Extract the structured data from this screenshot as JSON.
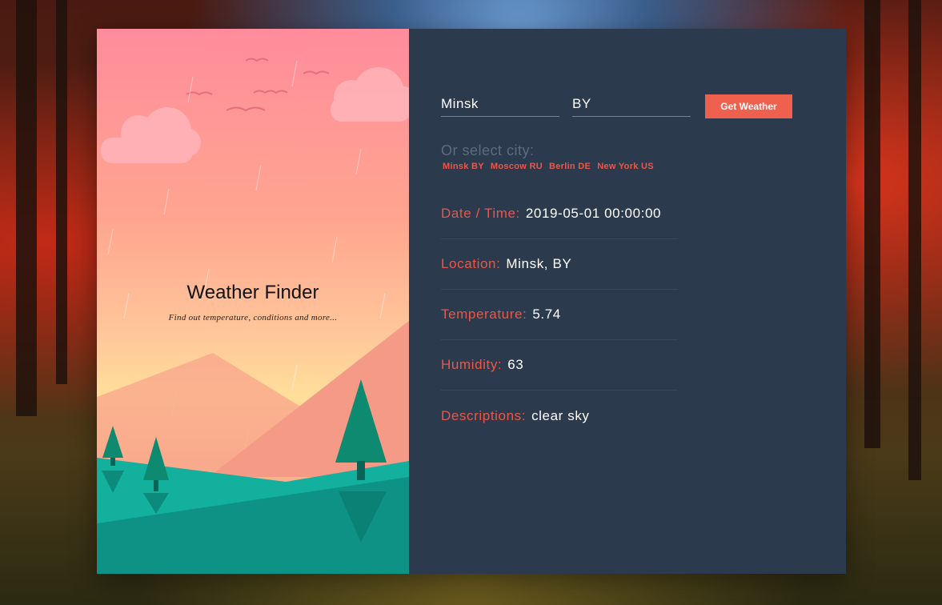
{
  "hero": {
    "title": "Weather Finder",
    "subtitle": "Find out temperature, conditions and more..."
  },
  "form": {
    "city_value": "Minsk",
    "country_value": "BY",
    "submit_label": "Get Weather"
  },
  "select_city": {
    "title": "Or select city:",
    "cities": [
      "Minsk BY",
      "Moscow RU",
      "Berlin DE",
      "New York US"
    ]
  },
  "weather": {
    "datetime": {
      "label": "Date / Time:",
      "value": "2019-05-01 00:00:00"
    },
    "location": {
      "label": "Location:",
      "value": "Minsk, BY"
    },
    "temperature": {
      "label": "Temperature:",
      "value": "5.74"
    },
    "humidity": {
      "label": "Humidity:",
      "value": "63"
    },
    "description": {
      "label": "Descriptions:",
      "value": "clear sky"
    }
  },
  "colors": {
    "accent": "#f0604e",
    "panel": "#2c3a4e",
    "muted": "#5f6b7e"
  }
}
